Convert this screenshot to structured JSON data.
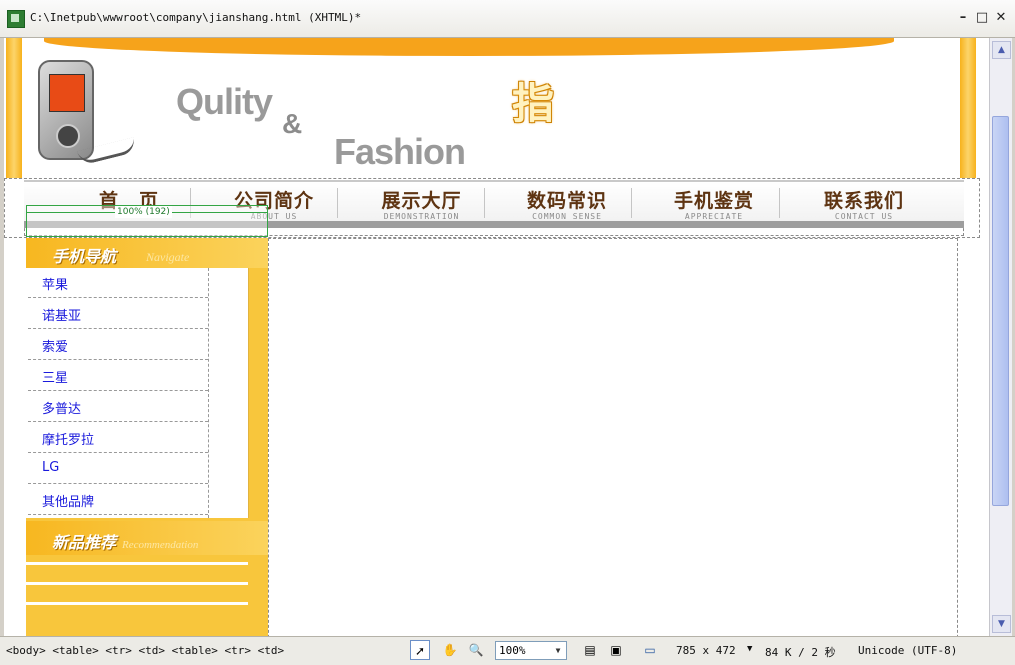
{
  "window": {
    "title": "C:\\Inetpub\\wwwroot\\company\\jianshang.html (XHTML)*",
    "buttons": {
      "minimize": "–",
      "restore": "□",
      "close": "✕"
    }
  },
  "header": {
    "slogan_word1": "Qulity",
    "slogan_amp": "&",
    "slogan_word2": "Fashion",
    "brand_char": "指"
  },
  "nav": {
    "items": [
      {
        "cn": "首　页",
        "en": ""
      },
      {
        "cn": "公司简介",
        "en": "ABOUT US"
      },
      {
        "cn": "展示大厅",
        "en": "DEMONSTRATION"
      },
      {
        "cn": "数码常识",
        "en": "COMMON SENSE"
      },
      {
        "cn": "手机鉴赏",
        "en": "APPRECIATE"
      },
      {
        "cn": "联系我们",
        "en": "CONTACT US"
      }
    ]
  },
  "table_width_label": "100% (192)",
  "sidebar": {
    "nav_title_cn": "手机导航",
    "nav_title_en": "Navigate",
    "brands": [
      "苹果",
      "诺基亚",
      "索爱",
      "三星",
      "多普达",
      "摩托罗拉",
      "LG",
      "其他品牌"
    ],
    "recommend_title_cn": "新品推荐",
    "recommend_title_en": "Recommendation"
  },
  "statusbar": {
    "tag_path": "<body> <table> <tr> <td> <table> <tr> <td>",
    "zoom": "100%",
    "dimensions": "785 x 472",
    "size_time": "84 K / 2 秒",
    "encoding": "Unicode (UTF-8)"
  },
  "colors": {
    "accent_orange": "#f6a31b",
    "nav_text": "#5e3412",
    "link_blue": "#1a1adc"
  }
}
